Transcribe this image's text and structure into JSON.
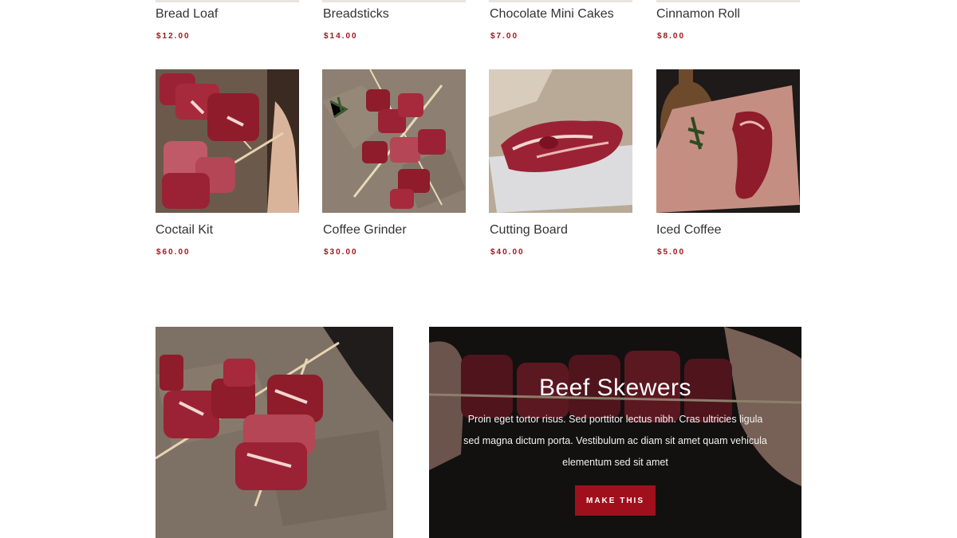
{
  "top_row": [
    {
      "name": "Bread Loaf",
      "price": "$12.00"
    },
    {
      "name": "Breadsticks",
      "price": "$14.00"
    },
    {
      "name": "Chocolate Mini Cakes",
      "price": "$7.00"
    },
    {
      "name": "Cinnamon Roll",
      "price": "$8.00"
    }
  ],
  "bottom_row": [
    {
      "name": "Coctail Kit",
      "price": "$60.00"
    },
    {
      "name": "Coffee Grinder",
      "price": "$30.00"
    },
    {
      "name": "Cutting Board",
      "price": "$40.00"
    },
    {
      "name": "Iced Coffee",
      "price": "$5.00"
    }
  ],
  "banner": {
    "title": "Beef Skewers",
    "text": "Proin eget tortor risus. Sed porttitor lectus nibh. Cras ultricies ligula sed magna dictum porta. Vestibulum ac diam sit amet quam vehicula elementum sed sit amet",
    "button_label": "MAKE THIS"
  },
  "colors": {
    "price": "#a0151e",
    "button": "#a0101c",
    "meat": "#8e1c2a"
  }
}
